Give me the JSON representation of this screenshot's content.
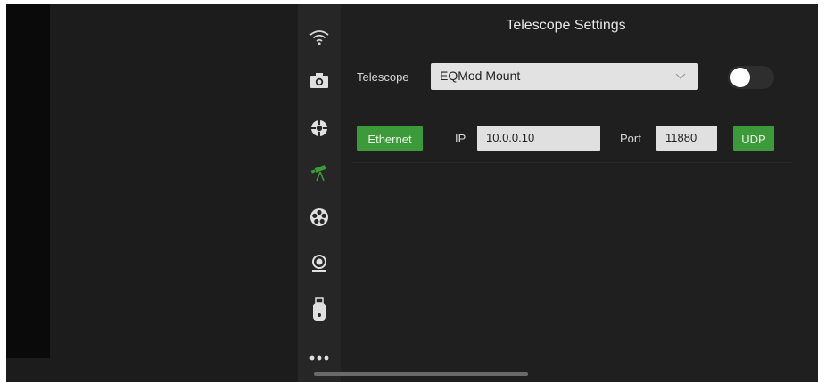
{
  "header": {
    "title": "Telescope Settings"
  },
  "sidebar": {
    "icons": [
      {
        "name": "wifi-icon"
      },
      {
        "name": "camera-icon"
      },
      {
        "name": "focuser-icon"
      },
      {
        "name": "telescope-icon",
        "active": true
      },
      {
        "name": "filter-wheel-icon"
      },
      {
        "name": "guide-camera-icon"
      },
      {
        "name": "usb-device-icon"
      },
      {
        "name": "more-icon"
      }
    ],
    "active_color": "#3c9a3a"
  },
  "telescope": {
    "label": "Telescope",
    "selected": "EQMod Mount",
    "enabled": false
  },
  "connection": {
    "mode_label": "Ethernet",
    "ip_label": "IP",
    "ip_value": "10.0.0.10",
    "port_label": "Port",
    "port_value": "11880",
    "protocol_label": "UDP"
  },
  "colors": {
    "accent": "#3c9a3a",
    "background": "#1f1f1f",
    "sidebar": "#262626"
  }
}
